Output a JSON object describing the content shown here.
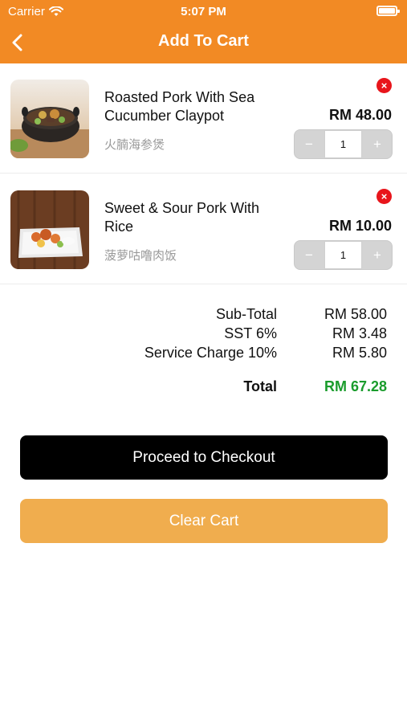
{
  "status_bar": {
    "carrier": "Carrier",
    "time": "5:07 PM"
  },
  "header": {
    "title": "Add To Cart"
  },
  "cart": {
    "items": [
      {
        "name": "Roasted Pork With Sea Cucumber Claypot",
        "name_cn": "火腩海参煲",
        "price": "RM 48.00",
        "qty": "1"
      },
      {
        "name": "Sweet & Sour Pork With Rice",
        "name_cn": "菠萝咕噜肉饭",
        "price": "RM 10.00",
        "qty": "1"
      }
    ],
    "remove_symbol": "×",
    "minus_symbol": "−",
    "plus_symbol": "+"
  },
  "summary": {
    "subtotal_label": "Sub-Total",
    "subtotal_value": "RM 58.00",
    "sst_label": "SST 6%",
    "sst_value": "RM 3.48",
    "service_label": "Service Charge 10%",
    "service_value": "RM 5.80",
    "total_label": "Total",
    "total_value": "RM 67.28"
  },
  "actions": {
    "checkout_label": "Proceed to Checkout",
    "clear_label": "Clear Cart"
  },
  "colors": {
    "brand": "#f28a24",
    "total_green": "#1a9c2c",
    "remove_red": "#e8151b",
    "clear_button": "#f0ad4e"
  },
  "icons": {
    "back": "chevron-left-icon",
    "wifi": "wifi-icon",
    "battery": "battery-icon",
    "remove": "remove-icon"
  }
}
